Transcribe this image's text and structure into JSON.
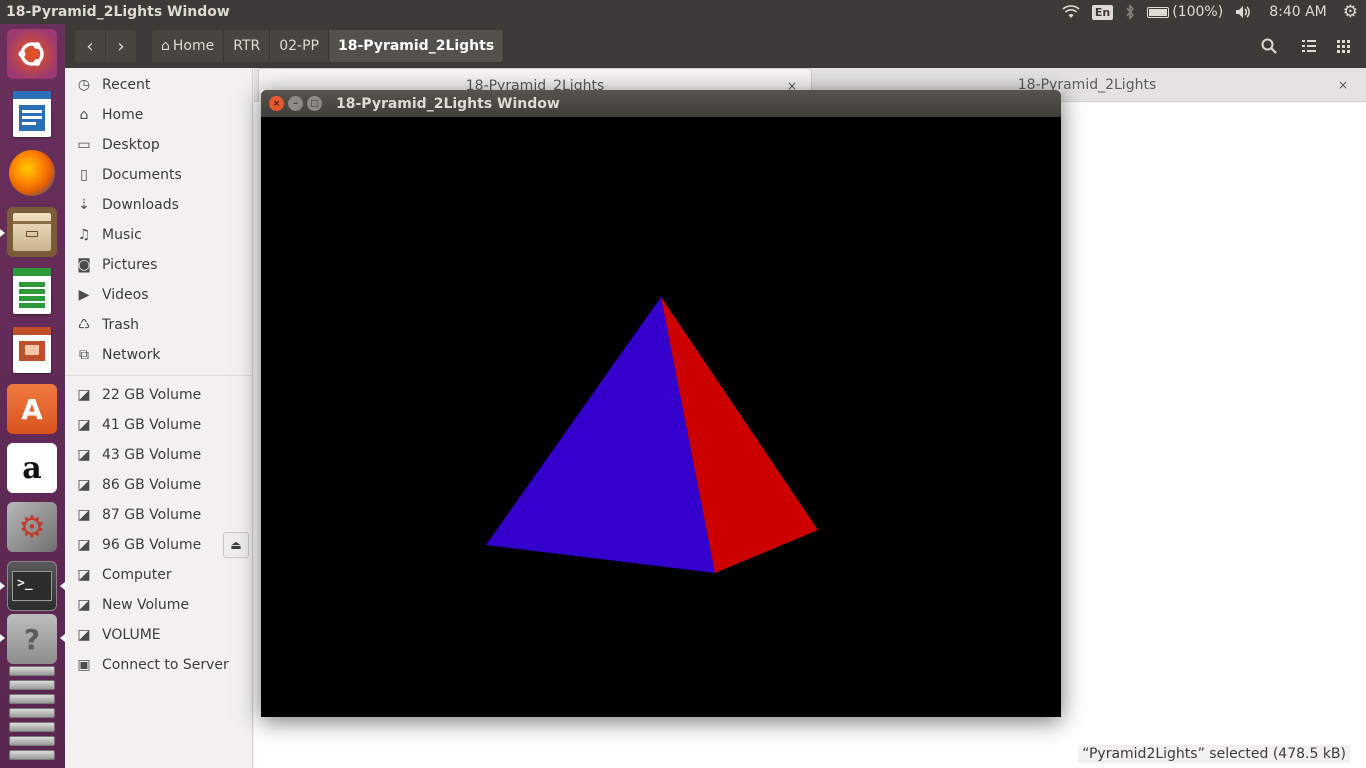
{
  "top_panel": {
    "title": "18-Pyramid_2Lights Window",
    "keyboard_layout": "En",
    "battery_text": "(100%)",
    "clock": "8:40 AM",
    "icons": [
      "wifi-icon",
      "bluetooth-icon",
      "battery-icon",
      "volume-icon",
      "settings-gear-icon"
    ]
  },
  "launcher": {
    "items": [
      {
        "name": "ubuntu-dash-icon",
        "color": "#e95420"
      },
      {
        "name": "libreoffice-writer-icon",
        "color": "#2a6fb8"
      },
      {
        "name": "firefox-icon",
        "color": "#e66000"
      },
      {
        "name": "files-icon",
        "color": "#7a5c3a"
      },
      {
        "name": "libreoffice-calc-icon",
        "color": "#2e9b3a"
      },
      {
        "name": "libreoffice-impress-icon",
        "color": "#c0502b"
      },
      {
        "name": "ubuntu-software-icon",
        "color": "#e0632b"
      },
      {
        "name": "amazon-icon",
        "color": "#ffffff"
      },
      {
        "name": "system-settings-icon",
        "color": "#8a8a8a"
      },
      {
        "name": "terminal-icon",
        "color": "#2c2c2c"
      },
      {
        "name": "help-icon",
        "color": "#9a9a9a"
      }
    ]
  },
  "file_manager": {
    "breadcrumbs": [
      "Home",
      "RTR",
      "02-PP",
      "18-Pyramid_2Lights"
    ],
    "tabs": [
      {
        "label": "18-Pyramid_2Lights",
        "close": "×"
      },
      {
        "label": "18-Pyramid_2Lights",
        "close": "×"
      }
    ],
    "sidebar": {
      "places": [
        {
          "label": "Recent",
          "icon": "clock-icon",
          "glyph": "◷"
        },
        {
          "label": "Home",
          "icon": "home-icon",
          "glyph": "⌂"
        },
        {
          "label": "Desktop",
          "icon": "desktop-icon",
          "glyph": "▭"
        },
        {
          "label": "Documents",
          "icon": "document-icon",
          "glyph": "▯"
        },
        {
          "label": "Downloads",
          "icon": "download-icon",
          "glyph": "⇣"
        },
        {
          "label": "Music",
          "icon": "music-icon",
          "glyph": "♫"
        },
        {
          "label": "Pictures",
          "icon": "camera-icon",
          "glyph": "◙"
        },
        {
          "label": "Videos",
          "icon": "video-icon",
          "glyph": "▶"
        },
        {
          "label": "Trash",
          "icon": "trash-icon",
          "glyph": "♺"
        },
        {
          "label": "Network",
          "icon": "network-icon",
          "glyph": "⧉"
        }
      ],
      "devices": [
        {
          "label": "22 GB Volume",
          "icon": "drive-icon",
          "glyph": "◪"
        },
        {
          "label": "41 GB Volume",
          "icon": "drive-icon",
          "glyph": "◪"
        },
        {
          "label": "43 GB Volume",
          "icon": "drive-icon",
          "glyph": "◪"
        },
        {
          "label": "86 GB Volume",
          "icon": "drive-icon",
          "glyph": "◪"
        },
        {
          "label": "87 GB Volume",
          "icon": "drive-icon",
          "glyph": "◪"
        },
        {
          "label": "96 GB Volume",
          "icon": "drive-icon",
          "glyph": "◪"
        },
        {
          "label": "Computer",
          "icon": "drive-icon",
          "glyph": "◪"
        },
        {
          "label": "New Volume",
          "icon": "drive-icon",
          "glyph": "◪"
        },
        {
          "label": "VOLUME",
          "icon": "drive-icon",
          "glyph": "◪"
        },
        {
          "label": "Connect to Server",
          "icon": "server-icon",
          "glyph": "▣"
        }
      ],
      "eject_glyph": "⏏"
    },
    "status": "“Pyramid2Lights” selected  (478.5 kB)"
  },
  "gl_window": {
    "title": "18-Pyramid_2Lights Window",
    "background": "#000000",
    "pyramid_faces": [
      {
        "name": "pyramid-face-blue",
        "color": "#3300cc"
      },
      {
        "name": "pyramid-face-red",
        "color": "#cc0000"
      }
    ]
  }
}
